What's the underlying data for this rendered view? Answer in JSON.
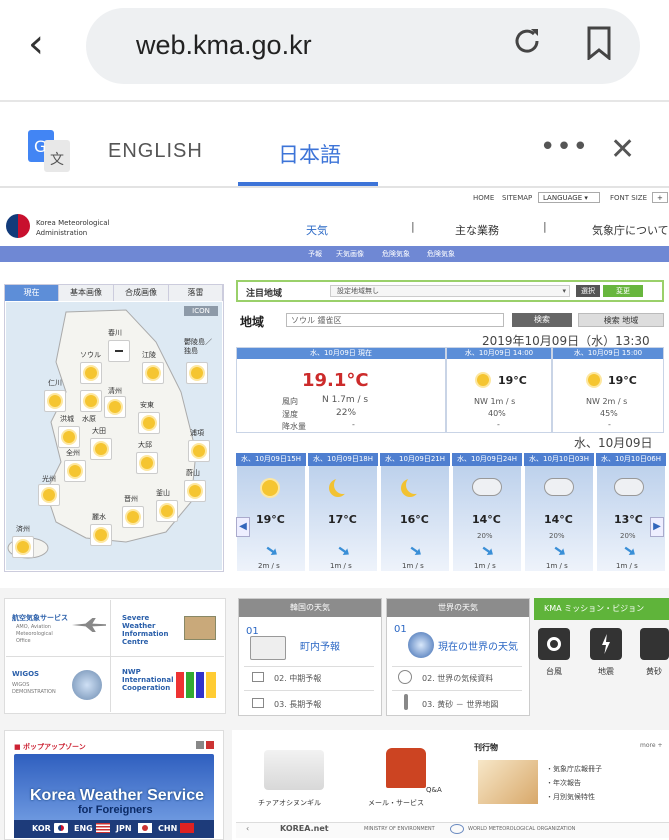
{
  "browser": {
    "url": "web.kma.go.kr"
  },
  "translate": {
    "lang1": "ENGLISH",
    "lang2": "日本語"
  },
  "util": {
    "home": "HOME",
    "sitemap": "SITEMAP",
    "language": "LANGUAGE",
    "font_size": "FONT SIZE",
    "plus": "+"
  },
  "logo": {
    "line1": "Korea Meteorological",
    "line2": "Administration"
  },
  "nav": {
    "items": [
      "天気",
      "主な業務",
      "気象庁について"
    ]
  },
  "subnav": {
    "items": [
      "予報",
      "天気画像",
      "危険気象",
      "危険気象"
    ]
  },
  "maptabs": {
    "items": [
      "現在",
      "基本画像",
      "合成画像",
      "落雷"
    ],
    "icon": "ICON"
  },
  "cities": [
    "春川",
    "ソウル",
    "江陵",
    "鬱陵島／独島",
    "仁川",
    "清州",
    "水原",
    "洪城",
    "安東",
    "大田",
    "浦項",
    "全州",
    "大邱",
    "光州",
    "蔚山",
    "晋州",
    "釜山",
    "麗水",
    "済州"
  ],
  "focus": {
    "label": "注目地域",
    "select": "設定地域無し",
    "btn1": "選択",
    "btn2": "変更"
  },
  "region": {
    "label": "地域",
    "value": "ソウル 鍾雀区",
    "search": "検索",
    "search2": "検索 地域"
  },
  "datetime": "2019年10月09日（水）13:30",
  "current": {
    "head": "水、10月09日 現在",
    "temp": "19.1°C",
    "wind_l": "風向",
    "wind_v": "N 1.7m / s",
    "hum_l": "湿度",
    "hum_v": "22%",
    "rain_l": "降水量",
    "rain_v": "-"
  },
  "forecast": [
    {
      "head": "水、10月09日 14:00",
      "temp": "19°C",
      "wind": "NW 1m / s",
      "pct": "40%",
      "dash": "-"
    },
    {
      "head": "水、10月09日 15:00",
      "temp": "19°C",
      "wind": "NW 2m / s",
      "pct": "45%",
      "dash": "-"
    }
  ],
  "day_label": "水、10月09日",
  "hourly": [
    {
      "head": "水、10月09日15H",
      "temp": "19°C",
      "pct": "",
      "wind": "2m / s"
    },
    {
      "head": "水、10月09日18H",
      "temp": "17°C",
      "pct": "",
      "wind": "1m / s"
    },
    {
      "head": "水、10月09日21H",
      "temp": "16°C",
      "pct": "",
      "wind": "1m / s"
    },
    {
      "head": "水、10月09日24H",
      "temp": "14°C",
      "pct": "20%",
      "wind": "1m / s"
    },
    {
      "head": "水、10月10日03H",
      "temp": "14°C",
      "pct": "20%",
      "wind": "1m / s"
    },
    {
      "head": "水、10月10日06H",
      "temp": "13°C",
      "pct": "20%",
      "wind": "1m / s"
    }
  ],
  "services": [
    {
      "title": "航空気象サービス",
      "sub": "AMO, Aviation Meteorological Office"
    },
    {
      "title": "Severe Weather Information Centre",
      "sub": ""
    },
    {
      "title": "WIGOS",
      "sub": "WIGOS DEMONSTRATION"
    },
    {
      "title": "NWP International Cooperation",
      "sub": ""
    }
  ],
  "korea_panel": {
    "head": "韓国の天気",
    "num": "01",
    "main": "町内予報",
    "items": [
      "02. 中期予報",
      "03. 長期予報"
    ]
  },
  "world_panel": {
    "head": "世界の天気",
    "num": "01",
    "main": "現在の世界の天気",
    "items": [
      "02. 世界の気候資料",
      "03. 黄砂 － 世界地図"
    ]
  },
  "kma": {
    "title": "KMA ミッション・ビジョン",
    "icons": [
      "台風",
      "地震",
      "黄砂"
    ]
  },
  "popup": {
    "title": "■ ポップアップゾーン",
    "kws": "Korea Weather Service",
    "kws_sub": "for Foreigners",
    "langs": [
      "KOR",
      "ENG",
      "JPN",
      "CHN"
    ]
  },
  "middle": {
    "a": "チァアオシヌンギル",
    "b": "メール・サービス",
    "qa": "Q&A"
  },
  "kankou": {
    "title": "刊行物",
    "more": "more +",
    "items": [
      "・気象庁広報冊子",
      "・年次報告",
      "・月別気候特性"
    ]
  },
  "footer": [
    "KOREA.net",
    "MINISTRY OF ENVIRONMENT",
    "WORLD METEOROLOGICAL ORGANIZATION"
  ],
  "colors": {
    "accent": "#3d74d8",
    "subbar": "#6f88d4",
    "green": "#68b63e",
    "red": "#cc2b2b"
  }
}
